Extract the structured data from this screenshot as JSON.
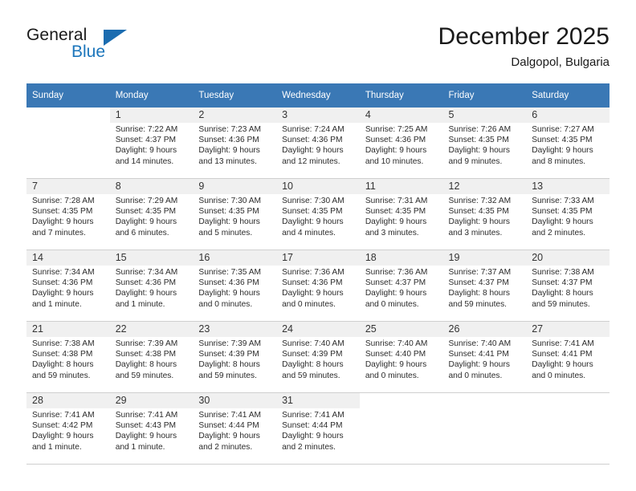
{
  "brand": {
    "name_part1": "General",
    "name_part2": "Blue",
    "accent_color": "#1b75bb"
  },
  "header": {
    "title": "December 2025",
    "location": "Dalgopol, Bulgaria"
  },
  "calendar": {
    "header_color": "#3a78b5",
    "weekdays": [
      "Sunday",
      "Monday",
      "Tuesday",
      "Wednesday",
      "Thursday",
      "Friday",
      "Saturday"
    ],
    "weeks": [
      [
        {
          "day": "",
          "sunrise": "",
          "sunset": "",
          "daylight1": "",
          "daylight2": ""
        },
        {
          "day": "1",
          "sunrise": "Sunrise: 7:22 AM",
          "sunset": "Sunset: 4:37 PM",
          "daylight1": "Daylight: 9 hours",
          "daylight2": "and 14 minutes."
        },
        {
          "day": "2",
          "sunrise": "Sunrise: 7:23 AM",
          "sunset": "Sunset: 4:36 PM",
          "daylight1": "Daylight: 9 hours",
          "daylight2": "and 13 minutes."
        },
        {
          "day": "3",
          "sunrise": "Sunrise: 7:24 AM",
          "sunset": "Sunset: 4:36 PM",
          "daylight1": "Daylight: 9 hours",
          "daylight2": "and 12 minutes."
        },
        {
          "day": "4",
          "sunrise": "Sunrise: 7:25 AM",
          "sunset": "Sunset: 4:36 PM",
          "daylight1": "Daylight: 9 hours",
          "daylight2": "and 10 minutes."
        },
        {
          "day": "5",
          "sunrise": "Sunrise: 7:26 AM",
          "sunset": "Sunset: 4:35 PM",
          "daylight1": "Daylight: 9 hours",
          "daylight2": "and 9 minutes."
        },
        {
          "day": "6",
          "sunrise": "Sunrise: 7:27 AM",
          "sunset": "Sunset: 4:35 PM",
          "daylight1": "Daylight: 9 hours",
          "daylight2": "and 8 minutes."
        }
      ],
      [
        {
          "day": "7",
          "sunrise": "Sunrise: 7:28 AM",
          "sunset": "Sunset: 4:35 PM",
          "daylight1": "Daylight: 9 hours",
          "daylight2": "and 7 minutes."
        },
        {
          "day": "8",
          "sunrise": "Sunrise: 7:29 AM",
          "sunset": "Sunset: 4:35 PM",
          "daylight1": "Daylight: 9 hours",
          "daylight2": "and 6 minutes."
        },
        {
          "day": "9",
          "sunrise": "Sunrise: 7:30 AM",
          "sunset": "Sunset: 4:35 PM",
          "daylight1": "Daylight: 9 hours",
          "daylight2": "and 5 minutes."
        },
        {
          "day": "10",
          "sunrise": "Sunrise: 7:30 AM",
          "sunset": "Sunset: 4:35 PM",
          "daylight1": "Daylight: 9 hours",
          "daylight2": "and 4 minutes."
        },
        {
          "day": "11",
          "sunrise": "Sunrise: 7:31 AM",
          "sunset": "Sunset: 4:35 PM",
          "daylight1": "Daylight: 9 hours",
          "daylight2": "and 3 minutes."
        },
        {
          "day": "12",
          "sunrise": "Sunrise: 7:32 AM",
          "sunset": "Sunset: 4:35 PM",
          "daylight1": "Daylight: 9 hours",
          "daylight2": "and 3 minutes."
        },
        {
          "day": "13",
          "sunrise": "Sunrise: 7:33 AM",
          "sunset": "Sunset: 4:35 PM",
          "daylight1": "Daylight: 9 hours",
          "daylight2": "and 2 minutes."
        }
      ],
      [
        {
          "day": "14",
          "sunrise": "Sunrise: 7:34 AM",
          "sunset": "Sunset: 4:36 PM",
          "daylight1": "Daylight: 9 hours",
          "daylight2": "and 1 minute."
        },
        {
          "day": "15",
          "sunrise": "Sunrise: 7:34 AM",
          "sunset": "Sunset: 4:36 PM",
          "daylight1": "Daylight: 9 hours",
          "daylight2": "and 1 minute."
        },
        {
          "day": "16",
          "sunrise": "Sunrise: 7:35 AM",
          "sunset": "Sunset: 4:36 PM",
          "daylight1": "Daylight: 9 hours",
          "daylight2": "and 0 minutes."
        },
        {
          "day": "17",
          "sunrise": "Sunrise: 7:36 AM",
          "sunset": "Sunset: 4:36 PM",
          "daylight1": "Daylight: 9 hours",
          "daylight2": "and 0 minutes."
        },
        {
          "day": "18",
          "sunrise": "Sunrise: 7:36 AM",
          "sunset": "Sunset: 4:37 PM",
          "daylight1": "Daylight: 9 hours",
          "daylight2": "and 0 minutes."
        },
        {
          "day": "19",
          "sunrise": "Sunrise: 7:37 AM",
          "sunset": "Sunset: 4:37 PM",
          "daylight1": "Daylight: 8 hours",
          "daylight2": "and 59 minutes."
        },
        {
          "day": "20",
          "sunrise": "Sunrise: 7:38 AM",
          "sunset": "Sunset: 4:37 PM",
          "daylight1": "Daylight: 8 hours",
          "daylight2": "and 59 minutes."
        }
      ],
      [
        {
          "day": "21",
          "sunrise": "Sunrise: 7:38 AM",
          "sunset": "Sunset: 4:38 PM",
          "daylight1": "Daylight: 8 hours",
          "daylight2": "and 59 minutes."
        },
        {
          "day": "22",
          "sunrise": "Sunrise: 7:39 AM",
          "sunset": "Sunset: 4:38 PM",
          "daylight1": "Daylight: 8 hours",
          "daylight2": "and 59 minutes."
        },
        {
          "day": "23",
          "sunrise": "Sunrise: 7:39 AM",
          "sunset": "Sunset: 4:39 PM",
          "daylight1": "Daylight: 8 hours",
          "daylight2": "and 59 minutes."
        },
        {
          "day": "24",
          "sunrise": "Sunrise: 7:40 AM",
          "sunset": "Sunset: 4:39 PM",
          "daylight1": "Daylight: 8 hours",
          "daylight2": "and 59 minutes."
        },
        {
          "day": "25",
          "sunrise": "Sunrise: 7:40 AM",
          "sunset": "Sunset: 4:40 PM",
          "daylight1": "Daylight: 9 hours",
          "daylight2": "and 0 minutes."
        },
        {
          "day": "26",
          "sunrise": "Sunrise: 7:40 AM",
          "sunset": "Sunset: 4:41 PM",
          "daylight1": "Daylight: 9 hours",
          "daylight2": "and 0 minutes."
        },
        {
          "day": "27",
          "sunrise": "Sunrise: 7:41 AM",
          "sunset": "Sunset: 4:41 PM",
          "daylight1": "Daylight: 9 hours",
          "daylight2": "and 0 minutes."
        }
      ],
      [
        {
          "day": "28",
          "sunrise": "Sunrise: 7:41 AM",
          "sunset": "Sunset: 4:42 PM",
          "daylight1": "Daylight: 9 hours",
          "daylight2": "and 1 minute."
        },
        {
          "day": "29",
          "sunrise": "Sunrise: 7:41 AM",
          "sunset": "Sunset: 4:43 PM",
          "daylight1": "Daylight: 9 hours",
          "daylight2": "and 1 minute."
        },
        {
          "day": "30",
          "sunrise": "Sunrise: 7:41 AM",
          "sunset": "Sunset: 4:44 PM",
          "daylight1": "Daylight: 9 hours",
          "daylight2": "and 2 minutes."
        },
        {
          "day": "31",
          "sunrise": "Sunrise: 7:41 AM",
          "sunset": "Sunset: 4:44 PM",
          "daylight1": "Daylight: 9 hours",
          "daylight2": "and 2 minutes."
        },
        {
          "day": "",
          "sunrise": "",
          "sunset": "",
          "daylight1": "",
          "daylight2": ""
        },
        {
          "day": "",
          "sunrise": "",
          "sunset": "",
          "daylight1": "",
          "daylight2": ""
        },
        {
          "day": "",
          "sunrise": "",
          "sunset": "",
          "daylight1": "",
          "daylight2": ""
        }
      ]
    ]
  }
}
